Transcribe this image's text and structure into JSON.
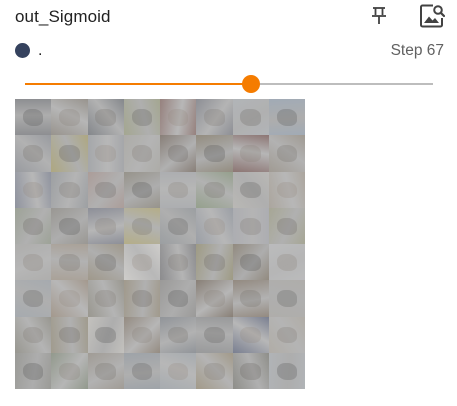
{
  "card": {
    "title": "out_Sigmoid",
    "pin_icon": "pin-icon",
    "image_view_icon": "image-search-icon"
  },
  "run": {
    "color": "#35425e",
    "name": "."
  },
  "step": {
    "label": "Step 67",
    "value": 67
  },
  "slider": {
    "fraction": 0.555,
    "accent_color": "#f57c00",
    "track_color": "#bdbdbd"
  },
  "sample": {
    "grid_rows": 8,
    "grid_cols": 8,
    "tiles": [
      [
        "#7d7f86",
        "#8f8577",
        "#6f7680",
        "#9aa06d",
        "#9a6a62",
        "#7b7f8d",
        "#a9b0b8",
        "#8ea4be"
      ],
      [
        "#8a8f9a",
        "#b0a046",
        "#9a9ea6",
        "#a7a49a",
        "#7f6a5a",
        "#8b7c5e",
        "#8f5a55",
        "#9a8e7c"
      ],
      [
        "#7c85a0",
        "#8f959c",
        "#b08e85",
        "#8d8572",
        "#a4a8ad",
        "#7f9a6c",
        "#b7b4ad",
        "#a99c8a"
      ],
      [
        "#8e9a80",
        "#8f8a80",
        "#7a7f94",
        "#b7a850",
        "#8c949b",
        "#8b94a4",
        "#a4a6b0",
        "#9f9f76"
      ],
      [
        "#a8a7a4",
        "#a99680",
        "#9b8b6c",
        "#d2cfc9",
        "#7b7b80",
        "#988f5a",
        "#8a7960",
        "#b7b8bb"
      ],
      [
        "#99a3ae",
        "#a38a70",
        "#8f8a78",
        "#9d8d6e",
        "#8f8d8a",
        "#7f6a55",
        "#8d7862",
        "#aaa69f"
      ],
      [
        "#8d8a7a",
        "#9b8f70",
        "#c4c0b8",
        "#8f7a63",
        "#7f8792",
        "#8b8d90",
        "#5e6b94",
        "#aea597"
      ],
      [
        "#8f8f86",
        "#7f8f72",
        "#9a8f80",
        "#8f9aa6",
        "#9aa4ae",
        "#a08d66",
        "#7f7f74",
        "#a8afb6"
      ]
    ]
  }
}
